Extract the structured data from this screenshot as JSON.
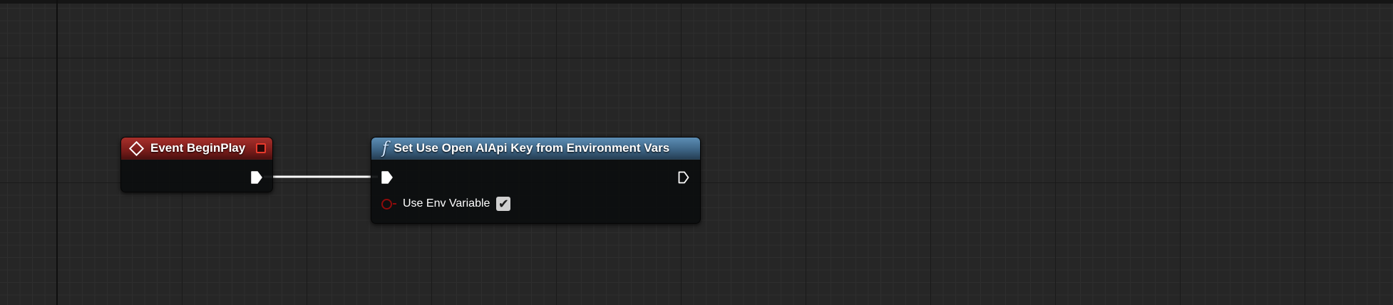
{
  "graph": {
    "background_color": "#262626",
    "grid_major_color": "#1a1a1a",
    "grid_minor_color": "#2e2e2e"
  },
  "event_node": {
    "title": "Event BeginPlay",
    "icon": "event-diamond-icon",
    "header_color": "#a8302b",
    "delegate_pin_color": "#e83a2c"
  },
  "function_node": {
    "icon_glyph": "f",
    "icon": "function-icon",
    "title": "Set Use Open AIApi Key from Environment Vars",
    "header_color": "#5d8eb5",
    "params": [
      {
        "label": "Use Env Variable",
        "type": "bool",
        "pin_color": "#8f0b0b",
        "checked": true,
        "check_glyph": "✔"
      }
    ]
  },
  "connection": {
    "from": "Event BeginPlay.exec_out",
    "to": "Set Use Open AIApi Key from Environment Vars.exec_in",
    "color": "#ffffff"
  }
}
